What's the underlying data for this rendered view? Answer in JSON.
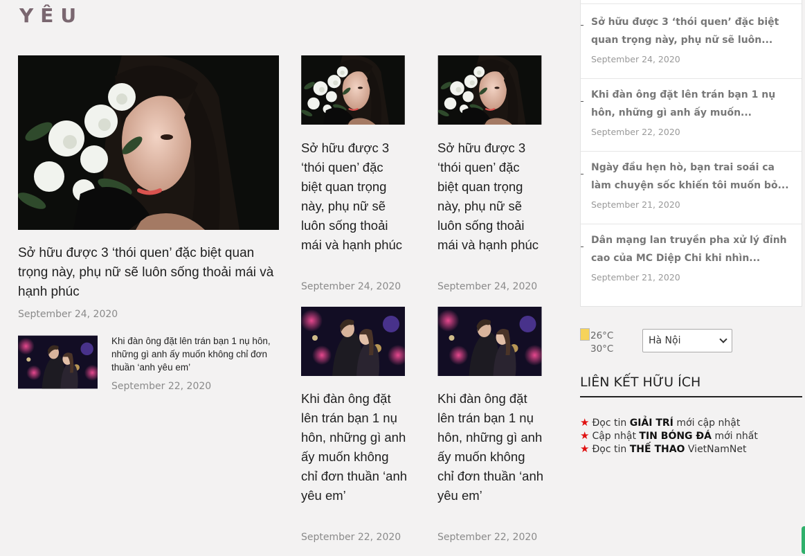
{
  "section": {
    "title": "YÊU"
  },
  "featured": {
    "title": "Sở hữu được 3 ‘thói quen’ đặc biệt quan trọng này, phụ nữ sẽ luôn sống thoải mái và hạnh phúc",
    "date": "September 24, 2020",
    "image": "woman-with-flowers"
  },
  "featured_small": {
    "title": "Khi đàn ông đặt lên trán bạn 1 nụ hôn, những gì anh ấy muốn không chỉ đơn thuần ‘anh yêu em’",
    "date": "September 22, 2020",
    "image": "couple-kiss"
  },
  "grid": [
    {
      "title": "Sở hữu được 3 ‘thói quen’ đặc biệt quan trọng này, phụ nữ sẽ luôn sống thoải mái và hạnh phúc",
      "date": "September 24, 2020",
      "image": "woman-with-flowers"
    },
    {
      "title": "Sở hữu được 3 ‘thói quen’ đặc biệt quan trọng này, phụ nữ sẽ luôn sống thoải mái và hạnh phúc",
      "date": "September 24, 2020",
      "image": "woman-with-flowers"
    },
    {
      "title": "Khi đàn ông đặt lên trán bạn 1 nụ hôn, những gì anh ấy muốn không chỉ đơn thuần ‘anh yêu em’",
      "date": "September 22, 2020",
      "image": "couple-kiss"
    },
    {
      "title": "Khi đàn ông đặt lên trán bạn 1 nụ hôn, những gì anh ấy muốn không chỉ đơn thuần ‘anh yêu em’",
      "date": "September 22, 2020",
      "image": "couple-kiss"
    }
  ],
  "sidebar_list": [
    {
      "title": "Sở hữu được 3 ‘thói quen’ đặc biệt quan trọng này, phụ nữ sẽ luôn...",
      "date": "September 24, 2020"
    },
    {
      "title": "Khi đàn ông đặt lên trán bạn 1 nụ hôn, những gì anh ấy muốn...",
      "date": "September 22, 2020"
    },
    {
      "title": "Ngày đầu hẹn hò, bạn trai soái ca làm chuyện sốc khiến tôi muốn bỏ...",
      "date": "September 21, 2020"
    },
    {
      "title": "Dân mạng lan truyền pha xử lý đỉnh cao của MC Diệp Chi khi nhìn...",
      "date": "September 21, 2020"
    }
  ],
  "weather": {
    "high": "26°C",
    "low": "30°C",
    "city": "Hà Nội"
  },
  "useful_links": {
    "heading": "LIÊN KẾT HỮU ÍCH",
    "items": [
      {
        "prefix": "Đọc tin",
        "bold": "GIẢI TRÍ",
        "suffix": "mới cập nhật"
      },
      {
        "prefix": "Cập nhật",
        "bold": "TIN BÓNG ĐÁ",
        "suffix": "mới nhất"
      },
      {
        "prefix": "Đọc tin",
        "bold": "THẾ THAO",
        "suffix": "VietNamNet"
      }
    ]
  },
  "colors": {
    "accent": "#7a6770",
    "star": "#e01010"
  }
}
